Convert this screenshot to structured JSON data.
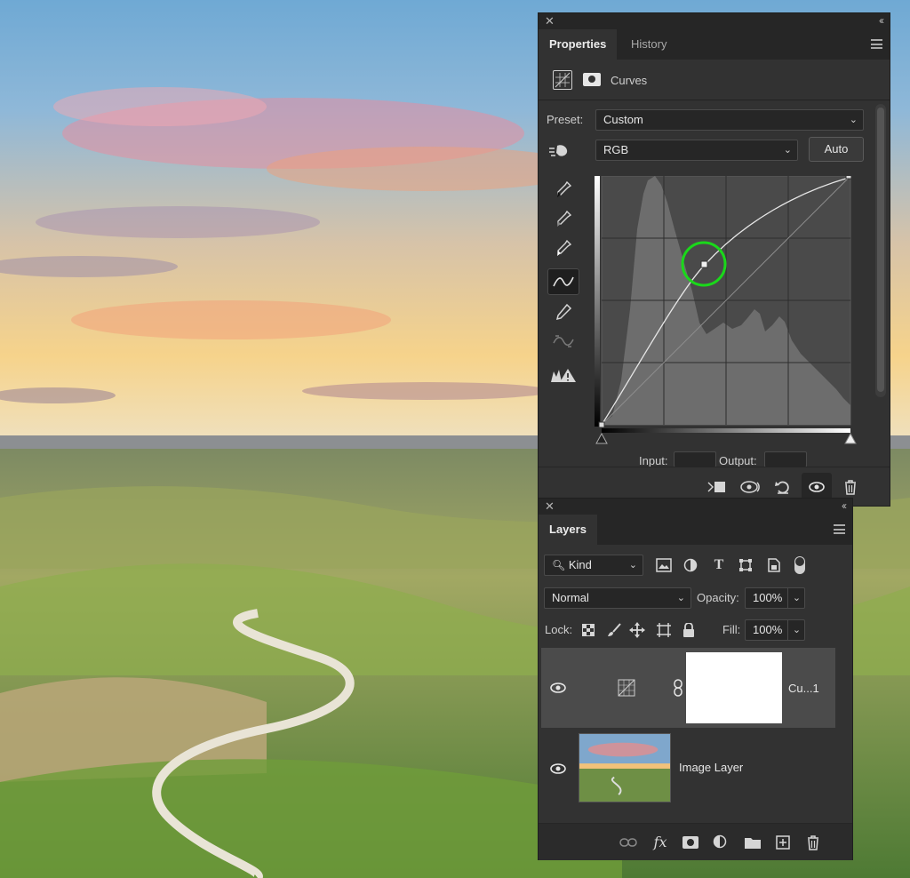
{
  "properties_panel": {
    "tabs": [
      "Properties",
      "History"
    ],
    "adjustment_name": "Curves",
    "preset_label": "Preset:",
    "preset_value": "Custom",
    "channel_value": "RGB",
    "auto_label": "Auto",
    "input_label": "Input:",
    "output_label": "Output:",
    "input_value": "",
    "output_value": "",
    "icons": {
      "header": [
        "curves-adjustment-icon",
        "layer-mask-icon"
      ],
      "tools": [
        "on-image-adjust-icon",
        "black-point-eyedropper-icon",
        "gray-point-eyedropper-icon",
        "white-point-eyedropper-icon",
        "curve-points-icon",
        "pencil-icon",
        "smooth-icon",
        "clipping-warning-icon"
      ],
      "footer": [
        "clip-to-layer-icon",
        "view-previous-state-icon",
        "reset-icon",
        "toggle-visibility-icon",
        "delete-icon"
      ]
    },
    "highlight_color": "#1ad81a"
  },
  "layers_panel": {
    "tab": "Layers",
    "filter_kind": "Kind",
    "blend_mode": "Normal",
    "opacity_label": "Opacity:",
    "opacity_value": "100%",
    "lock_label": "Lock:",
    "fill_label": "Fill:",
    "fill_value": "100%",
    "filter_icons": [
      "pixel-filter-icon",
      "adjustment-filter-icon",
      "type-filter-icon",
      "shape-filter-icon",
      "smart-object-filter-icon"
    ],
    "lock_icons": [
      "lock-transparent-icon",
      "lock-image-icon",
      "lock-position-icon",
      "lock-artboard-icon",
      "lock-all-icon"
    ],
    "layers": [
      {
        "name": "Cu...1",
        "visible": true,
        "selected": true
      },
      {
        "name": "Image Layer",
        "visible": true,
        "selected": false
      }
    ],
    "bottom_icons": [
      "link-layers-icon",
      "fx-icon",
      "add-mask-icon",
      "new-adjustment-icon",
      "new-group-icon",
      "new-layer-icon",
      "delete-layer-icon"
    ],
    "fx_label": "fx"
  }
}
